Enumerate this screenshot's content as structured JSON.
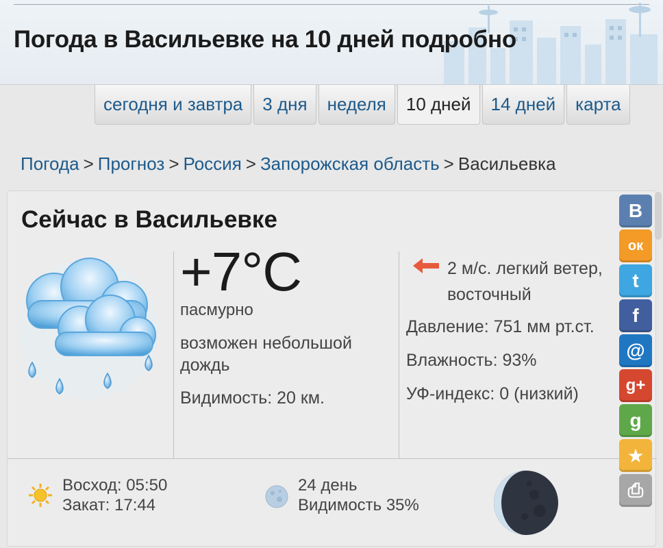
{
  "header": {
    "title": "Погода в Васильевке на 10 дней подробно"
  },
  "tabs": [
    {
      "label": "сегодня и завтра",
      "active": false
    },
    {
      "label": "3 дня",
      "active": false
    },
    {
      "label": "неделя",
      "active": false
    },
    {
      "label": "10 дней",
      "active": true
    },
    {
      "label": "14 дней",
      "active": false
    },
    {
      "label": "карта",
      "active": false
    }
  ],
  "breadcrumb": {
    "items": [
      "Погода",
      "Прогноз",
      "Россия",
      "Запорожская область"
    ],
    "separator": ">",
    "current": "Васильевка"
  },
  "now": {
    "title": "Сейчас в Васильевке",
    "icon": "cloud-rain-icon",
    "temperature": "+7°C",
    "condition": "пасмурно",
    "rain_note": "возможен небольшой дождь",
    "visibility": "Видимость: 20 км.",
    "wind": "2 м/с. легкий ветер, восточный",
    "pressure": "Давление: 751 мм рт.ст.",
    "humidity": "Влажность: 93%",
    "uv": "УФ-индекс: 0 (низкий)"
  },
  "sun": {
    "sunrise": "Восход: 05:50",
    "sunset": "Закат: 17:44"
  },
  "moon": {
    "day": "24 день",
    "visibility": "Видимость 35%"
  },
  "share": [
    {
      "name": "vk-button",
      "icon": "vk-icon",
      "glyph": "B",
      "color": "#5b80b0"
    },
    {
      "name": "odnoklassniki-button",
      "icon": "odnoklassniki-icon",
      "glyph": "ок",
      "color": "#f39a27"
    },
    {
      "name": "twitter-button",
      "icon": "twitter-icon",
      "glyph": "t",
      "color": "#3ea6e0"
    },
    {
      "name": "facebook-button",
      "icon": "facebook-icon",
      "glyph": "f",
      "color": "#415f9e"
    },
    {
      "name": "mailru-button",
      "icon": "at-icon",
      "glyph": "@",
      "color": "#1f77c2"
    },
    {
      "name": "googleplus-button",
      "icon": "google-plus-icon",
      "glyph": "g+",
      "color": "#d6472f"
    },
    {
      "name": "google-button",
      "icon": "google-icon",
      "glyph": "g",
      "color": "#5fa84a"
    },
    {
      "name": "bookmark-button",
      "icon": "star-icon",
      "glyph": "★",
      "color": "#f2b43a"
    },
    {
      "name": "print-button",
      "icon": "printer-icon",
      "glyph": "⎙",
      "color": "#a7a7a7"
    }
  ]
}
